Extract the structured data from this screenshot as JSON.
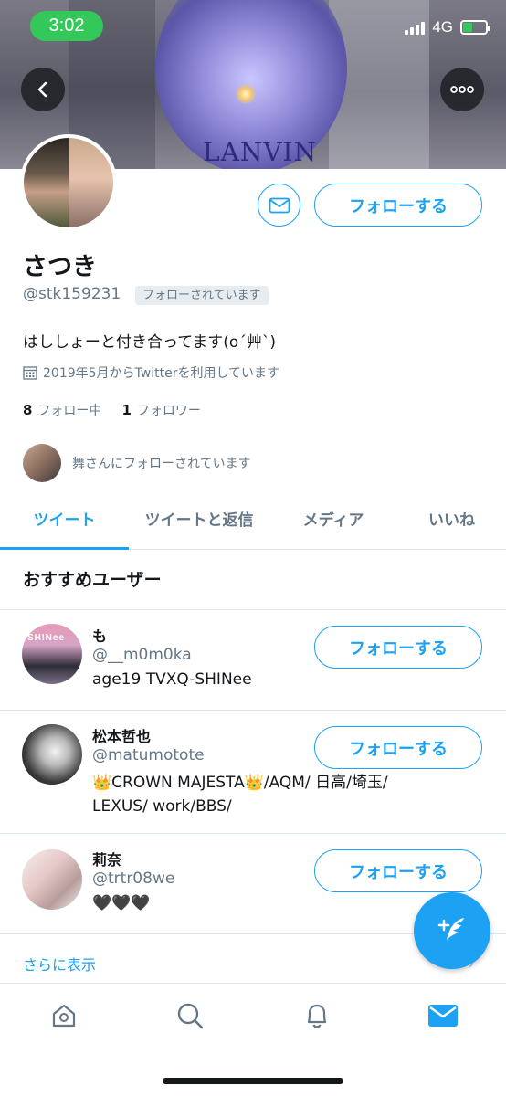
{
  "status_bar": {
    "time": "3:02",
    "network": "4G"
  },
  "banner": {
    "brand_text": "LANVIN"
  },
  "profile": {
    "display_name": "さつき",
    "handle": "@stk159231",
    "follows_you": "フォローされています",
    "bio": "はししょーと付き合ってます(o´艸`)",
    "joined": "2019年5月からTwitterを利用しています",
    "following_count": "8",
    "following_label": "フォロー中",
    "followers_count": "1",
    "followers_label": "フォロワー",
    "followed_by": "舞さんにフォローされています",
    "follow_button": "フォローする"
  },
  "tabs": [
    {
      "label": "ツイート",
      "active": true
    },
    {
      "label": "ツイートと返信",
      "active": false
    },
    {
      "label": "メディア",
      "active": false
    },
    {
      "label": "いいね",
      "active": false
    }
  ],
  "recommended": {
    "title": "おすすめユーザー",
    "users": [
      {
        "name": "も",
        "handle": "@__m0m0ka",
        "bio": "age19 TVXQ-SHINee",
        "follow": "フォローする",
        "avatar_text": "SHINee"
      },
      {
        "name": "松本哲也",
        "handle": "@matumototе",
        "bio_line1": "👑CROWN MAJESTA👑/AQM/ 日高/埼玉/",
        "bio_line2": "LEXUS/ work/BBS/",
        "follow": "フォローする"
      },
      {
        "name": "莉奈",
        "handle": "@trtr08we",
        "bio": "🖤🖤🖤",
        "follow": "フォローする"
      }
    ],
    "show_more": "さらに表示"
  },
  "colors": {
    "accent": "#1da1f2",
    "secondary_text": "#657786",
    "status_green": "#34c759"
  },
  "nav": [
    "home-icon",
    "search-icon",
    "bell-icon",
    "mail-icon"
  ]
}
